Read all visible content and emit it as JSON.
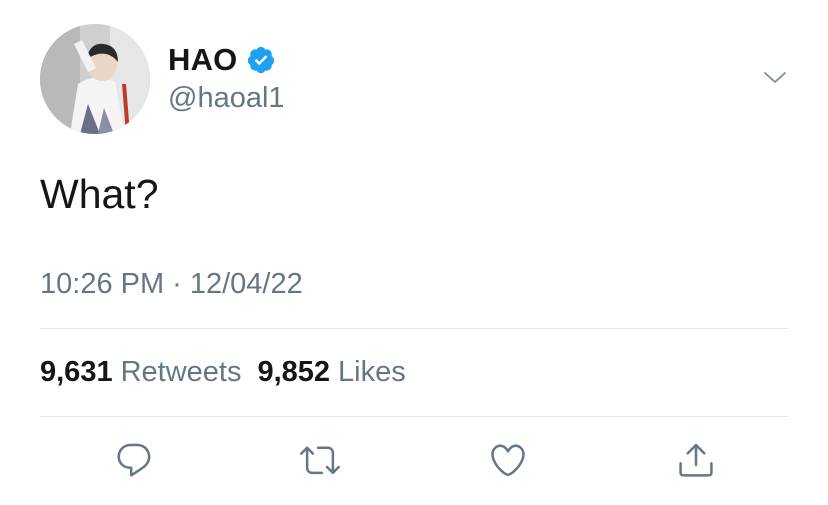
{
  "tweet": {
    "display_name": "HAO",
    "handle": "@haoal1",
    "verified": true,
    "text": "What?",
    "time": "10:26 PM",
    "separator": "·",
    "date": "12/04/22"
  },
  "stats": {
    "retweets_count": "9,631",
    "retweets_label": "Retweets",
    "likes_count": "9,852",
    "likes_label": "Likes"
  },
  "icons": {
    "verified": "verified-badge-icon",
    "menu": "chevron-down-icon",
    "reply": "reply-icon",
    "retweet": "retweet-icon",
    "like": "heart-icon",
    "share": "share-icon"
  },
  "colors": {
    "text_primary": "#14171a",
    "text_secondary": "#657786",
    "verified_blue": "#1da1f2",
    "divider": "#e1e8ed"
  }
}
